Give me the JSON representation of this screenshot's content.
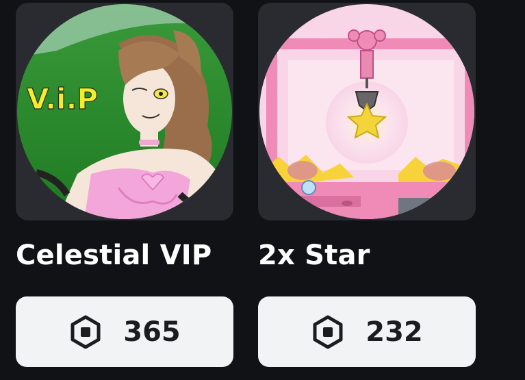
{
  "items": [
    {
      "name": "Celestial VIP",
      "price": "365",
      "thumbnail_text": "V.i.P",
      "currency_icon": "robux-icon"
    },
    {
      "name": "2x Star",
      "price": "232",
      "currency_icon": "robux-icon"
    }
  ],
  "colors": {
    "background": "#111216",
    "button_bg": "#f2f3f5",
    "text_primary": "#ffffff",
    "price_text": "#1b1c20"
  }
}
